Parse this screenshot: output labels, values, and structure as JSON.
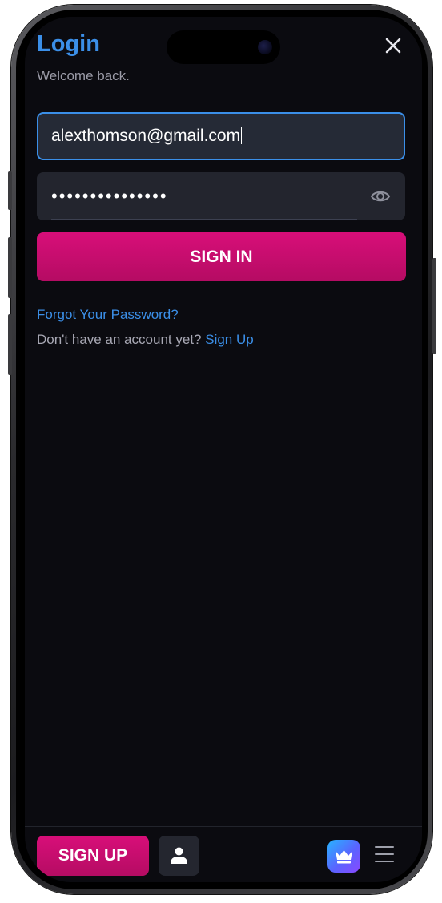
{
  "header": {
    "title": "Login",
    "subtitle": "Welcome back."
  },
  "form": {
    "email_value": "alexthomson@gmail.com",
    "password_masked": "•••••••••••••••",
    "signin_label": "SIGN IN"
  },
  "links": {
    "forgot_password": "Forgot Your Password?",
    "no_account_prompt": "Don't have an account yet?",
    "sign_up": "Sign Up"
  },
  "bottom_bar": {
    "signup_label": "SIGN UP",
    "icons": [
      "user-icon",
      "crown-icon",
      "hamburger-menu-icon"
    ]
  },
  "colors": {
    "accent_blue": "#3b8fe8",
    "brand_pink": "#c90d6d",
    "background": "#0b0b10",
    "input_bg": "#252a36"
  },
  "icons": {
    "close": "close-icon",
    "eye": "eye-icon"
  }
}
